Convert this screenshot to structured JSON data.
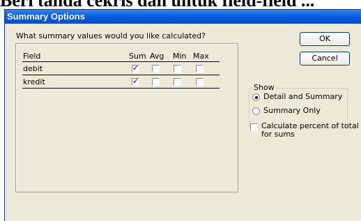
{
  "background_text": "Beri tanda cekris dan untuk field-field ...",
  "dialog": {
    "title": "Summary Options",
    "prompt": "What summary values would you like calculated?",
    "columns": {
      "field": "Field",
      "sum": "Sum",
      "avg": "Avg",
      "min": "Min",
      "max": "Max"
    },
    "rows": [
      {
        "field": "debit",
        "sum": true,
        "avg": false,
        "min": false,
        "max": false
      },
      {
        "field": "kredit",
        "sum": true,
        "avg": false,
        "min": false,
        "max": false
      }
    ],
    "buttons": {
      "ok": "OK",
      "cancel": "Cancel"
    },
    "show_group": {
      "label": "Show",
      "option_detail": "Detail and Summary",
      "option_summary": "Summary Only",
      "selected": "detail"
    },
    "percent_checkbox": {
      "label": "Calculate percent of total for sums",
      "checked": false
    }
  },
  "colors": {
    "title_bar": "#0a5ee0",
    "dialog_bg": "#ece9d8"
  }
}
